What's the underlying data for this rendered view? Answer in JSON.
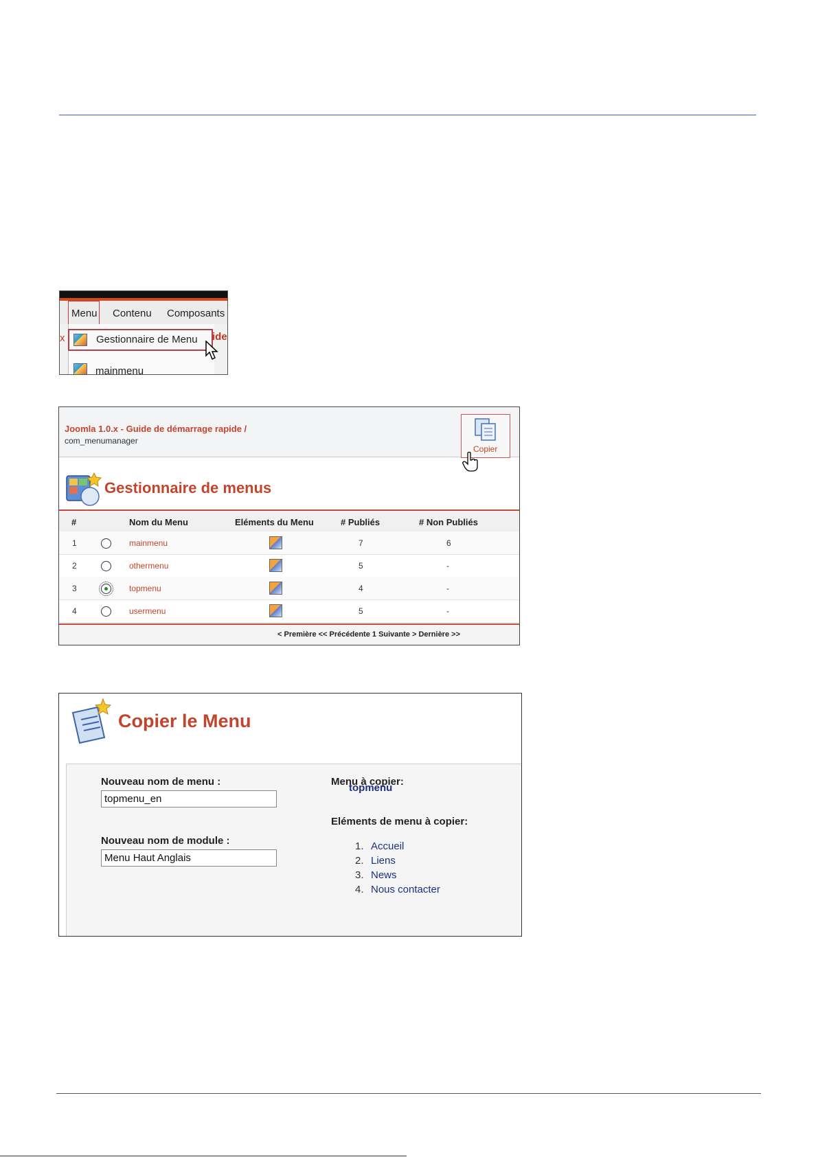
{
  "shot1": {
    "menubar": [
      "Menu",
      "Contenu",
      "Composants"
    ],
    "left_fragment": "x",
    "right_fragment": "ide",
    "dropdown": [
      "Gestionnaire de Menu",
      "mainmenu"
    ]
  },
  "shot2": {
    "breadcrumb": "Joomla 1.0.x - Guide de démarrage rapide /",
    "breadcrumb_sub": "com_menumanager",
    "copy_label": "Copier",
    "title": "Gestionnaire de menus",
    "columns": [
      "#",
      "Nom du Menu",
      "Eléments du Menu",
      "# Publiés",
      "# Non Publiés"
    ],
    "rows": [
      {
        "num": "1",
        "name": "mainmenu",
        "published": "7",
        "unpublished": "6",
        "selected": false
      },
      {
        "num": "2",
        "name": "othermenu",
        "published": "5",
        "unpublished": "-",
        "selected": false
      },
      {
        "num": "3",
        "name": "topmenu",
        "published": "4",
        "unpublished": "-",
        "selected": true
      },
      {
        "num": "4",
        "name": "usermenu",
        "published": "5",
        "unpublished": "-",
        "selected": false
      }
    ],
    "pager": "< Première << Précédente 1 Suivante > Dernière >>"
  },
  "shot3": {
    "title": "Copier le Menu",
    "new_menu_label": "Nouveau nom de menu :",
    "new_menu_value": "topmenu_en",
    "new_module_label": "Nouveau nom de module :",
    "new_module_value": "Menu Haut Anglais",
    "menu_to_copy_label": "Menu à copier:",
    "menu_to_copy_value": "topmenu",
    "items_label": "Eléments de menu à copier:",
    "items": [
      {
        "num": "1.",
        "text": "Accueil"
      },
      {
        "num": "2.",
        "text": "Liens"
      },
      {
        "num": "3.",
        "text": "News"
      },
      {
        "num": "4.",
        "text": "Nous contacter"
      }
    ]
  }
}
